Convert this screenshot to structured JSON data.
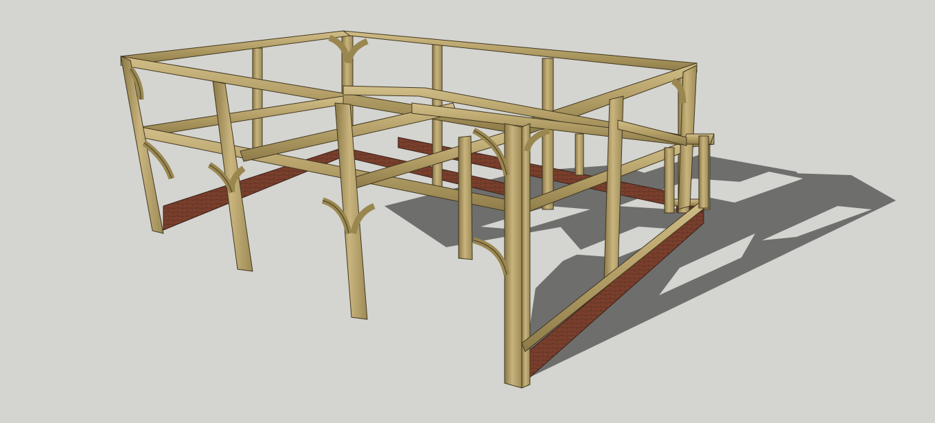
{
  "scene": {
    "subject": "oak-timber-frame-3d-model",
    "colors": {
      "background": "#d4d4d0",
      "shadow": "#6e6e6c",
      "timber_light": "#c7b27c",
      "timber_mid": "#a8955e",
      "timber_dark": "#7c6c40",
      "timber_edge": "#3f3620",
      "brick": "#7a3f2c",
      "brick_dark": "#4e2a20"
    }
  }
}
